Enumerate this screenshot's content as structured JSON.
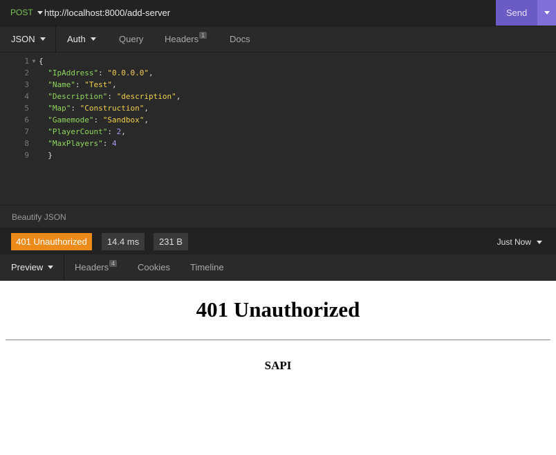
{
  "request": {
    "method": "POST",
    "url": "http://localhost:8000/add-server",
    "send_label": "Send"
  },
  "request_tabs": [
    {
      "label": "JSON"
    },
    {
      "label": "Auth"
    },
    {
      "label": "Query"
    },
    {
      "label": "Headers",
      "badge": "1"
    },
    {
      "label": "Docs"
    }
  ],
  "editor": {
    "lines": [
      {
        "num": "1",
        "text": "{"
      },
      {
        "num": "2",
        "key": "\"IpAddress\"",
        "value": "\"0.0.0.0\"",
        "tail": ","
      },
      {
        "num": "3",
        "key": "\"Name\"",
        "value": "\"Test\"",
        "tail": ","
      },
      {
        "num": "4",
        "key": "\"Description\"",
        "value": "\"description\"",
        "tail": ","
      },
      {
        "num": "5",
        "key": "\"Map\"",
        "value": "\"Construction\"",
        "tail": ","
      },
      {
        "num": "6",
        "key": "\"Gamemode\"",
        "value": "\"Sandbox\"",
        "tail": ","
      },
      {
        "num": "7",
        "key": "\"PlayerCount\"",
        "value": "2",
        "tail": ","
      },
      {
        "num": "8",
        "key": "\"MaxPlayers\"",
        "value": "4",
        "tail": ""
      },
      {
        "num": "9",
        "text": "}"
      }
    ],
    "beautify_label": "Beautify JSON"
  },
  "response": {
    "status": "401 Unauthorized",
    "time": "14.4 ms",
    "size": "231 B",
    "when": "Just Now"
  },
  "response_tabs": [
    {
      "label": "Preview"
    },
    {
      "label": "Headers",
      "badge": "4"
    },
    {
      "label": "Cookies"
    },
    {
      "label": "Timeline"
    }
  ],
  "preview": {
    "heading": "401 Unauthorized",
    "server": "SAPI"
  },
  "colors": {
    "send": "#6b5bc4",
    "status_error": "#ec8b1a",
    "method": "#7cc452"
  },
  "icons": [
    "chevron-down-icon",
    "fold-arrow-icon"
  ]
}
